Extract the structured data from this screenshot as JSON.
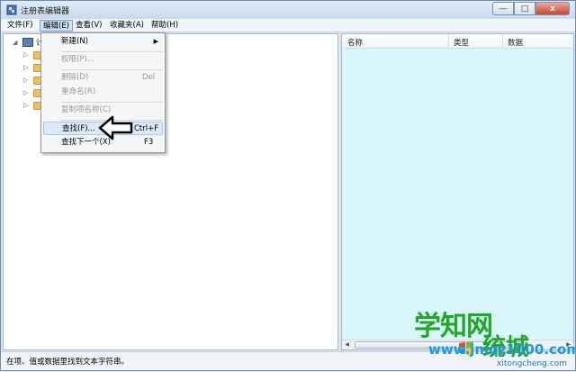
{
  "window": {
    "title": "注册表编辑器",
    "controls": {
      "minimize": "—",
      "maximize": "□",
      "close": "x"
    }
  },
  "menubar": {
    "items": [
      {
        "label": "文件(F)"
      },
      {
        "label": "编辑(E)"
      },
      {
        "label": "查看(V)"
      },
      {
        "label": "收藏夹(A)"
      },
      {
        "label": "帮助(H)"
      }
    ]
  },
  "tree": {
    "root_label": "计",
    "folders": [
      "",
      "",
      "",
      "",
      ""
    ]
  },
  "edit_menu": {
    "items": [
      {
        "label": "新建(N)",
        "shortcut": "",
        "disabled": false,
        "submenu": true
      },
      {
        "label": "权限(P)...",
        "shortcut": "",
        "disabled": true
      },
      {
        "label": "删除(D)",
        "shortcut": "Del",
        "disabled": true
      },
      {
        "label": "重命名(R)",
        "shortcut": "",
        "disabled": true
      },
      {
        "label": "复制项名称(C)",
        "shortcut": "",
        "disabled": true
      },
      {
        "label": "查找(F)...",
        "shortcut": "Ctrl+F",
        "disabled": false,
        "highlighted": true
      },
      {
        "label": "查找下一个(X)",
        "shortcut": "F3",
        "disabled": false
      }
    ]
  },
  "list_view": {
    "columns": [
      "名称",
      "类型",
      "数据"
    ]
  },
  "statusbar": {
    "text": "在项、值或数据里找到文本字符串。"
  },
  "watermark": {
    "main": "学知网",
    "sub": "统城",
    "url": "www.jmqz1000.com",
    "url2": "xitongcheng.com"
  },
  "colors": {
    "list_bg": "#d9f6fb",
    "watermark_green": "#21a829",
    "watermark_blue": "#1d9bd8"
  }
}
